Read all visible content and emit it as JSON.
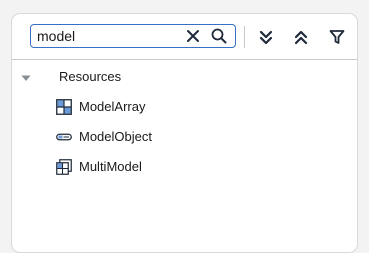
{
  "search": {
    "value": "model",
    "placeholder": ""
  },
  "toolbar": {
    "clear_icon": "close-icon",
    "search_icon": "search-icon",
    "expand_all_icon": "double-chevron-down-icon",
    "collapse_all_icon": "double-chevron-up-icon",
    "filter_icon": "filter-icon"
  },
  "tree": {
    "root": {
      "label": "Resources",
      "expanded": true
    },
    "items": [
      {
        "label": "ModelArray",
        "icon": "model-array-icon"
      },
      {
        "label": "ModelObject",
        "icon": "model-object-icon"
      },
      {
        "label": "MultiModel",
        "icon": "multi-model-icon"
      }
    ]
  },
  "colors": {
    "accent": "#3a6dc4",
    "icon_dark": "#1e2a3a",
    "icon_blue": "#6a9bd8"
  }
}
